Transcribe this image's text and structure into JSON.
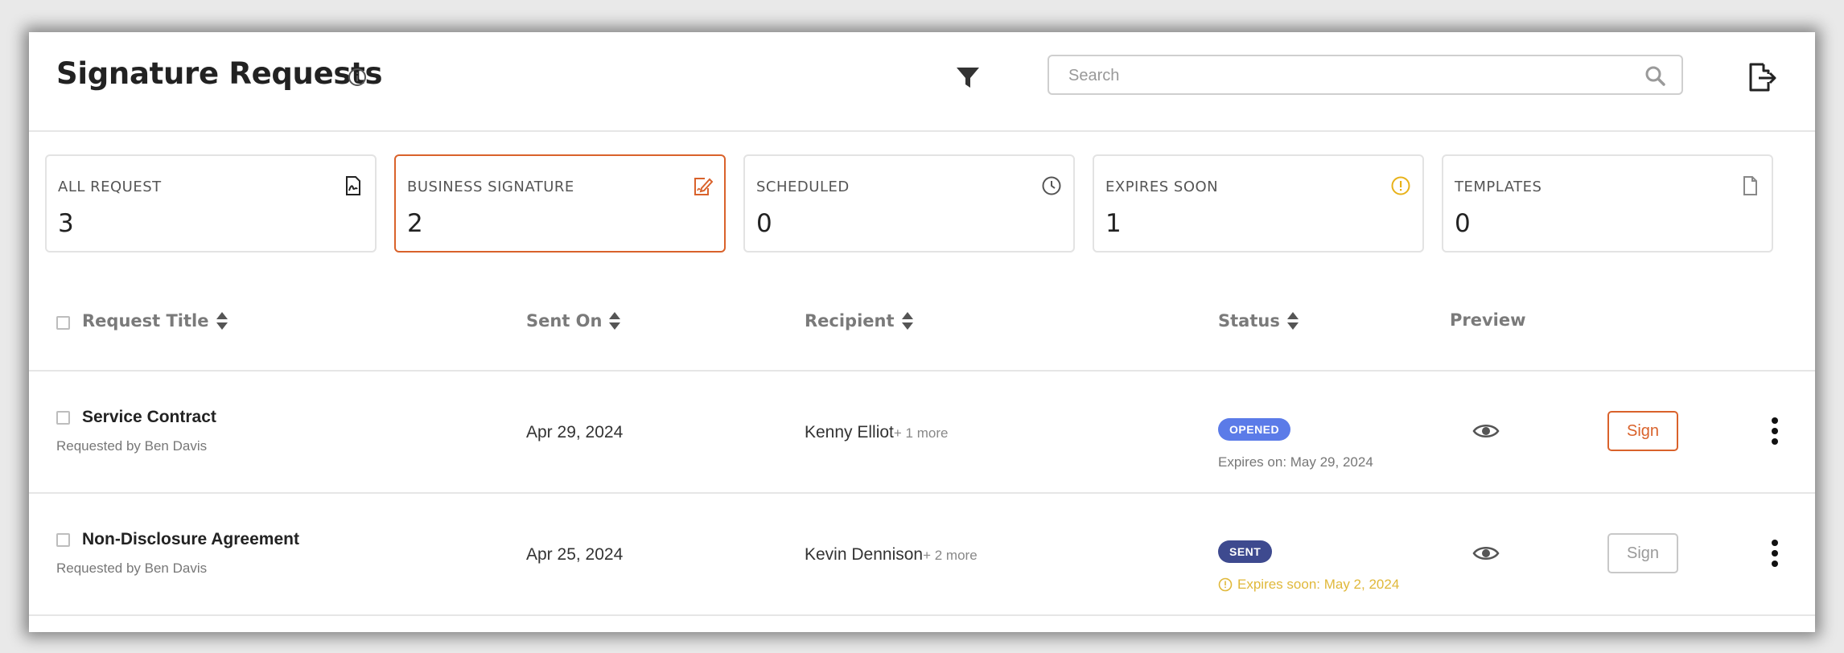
{
  "header": {
    "title": "Signature Requests",
    "search_placeholder": "Search",
    "icons": {
      "info": "info-icon",
      "filter": "filter-icon",
      "search": "search-icon",
      "export": "export-icon"
    }
  },
  "cards": [
    {
      "label": "ALL REQUEST",
      "value": "3",
      "icon": "document-signature-icon"
    },
    {
      "label": "BUSINESS SIGNATURE",
      "value": "2",
      "icon": "signature-edit-icon",
      "active": true
    },
    {
      "label": "SCHEDULED",
      "value": "0",
      "icon": "clock-icon"
    },
    {
      "label": "EXPIRES SOON",
      "value": "1",
      "icon": "alert-icon"
    },
    {
      "label": "TEMPLATES",
      "value": "0",
      "icon": "file-icon"
    }
  ],
  "table": {
    "columns": [
      "Request Title",
      "Sent On",
      "Recipient",
      "Status",
      "Preview"
    ],
    "rows": [
      {
        "title": "Service Contract",
        "requested_by": "Requested by Ben Davis",
        "sent_on": "Apr 29, 2024",
        "recipient": "Kenny Elliot",
        "recipient_more": "+ 1 more",
        "status": "OPENED",
        "expires": "Expires on: May 29, 2024",
        "sign_label": "Sign"
      },
      {
        "title": "Non-Disclosure Agreement",
        "requested_by": "Requested by Ben Davis",
        "sent_on": "Apr 25, 2024",
        "recipient": "Kevin Dennison",
        "recipient_more": "+ 2 more",
        "status": "SENT",
        "expires": "Expires soon: May 2, 2024",
        "sign_label": "Sign"
      }
    ]
  },
  "colors": {
    "accent": "#d9622b",
    "opened_badge": "#5b7be8",
    "sent_badge": "#3e4a8f",
    "warning": "#e0b83a"
  }
}
